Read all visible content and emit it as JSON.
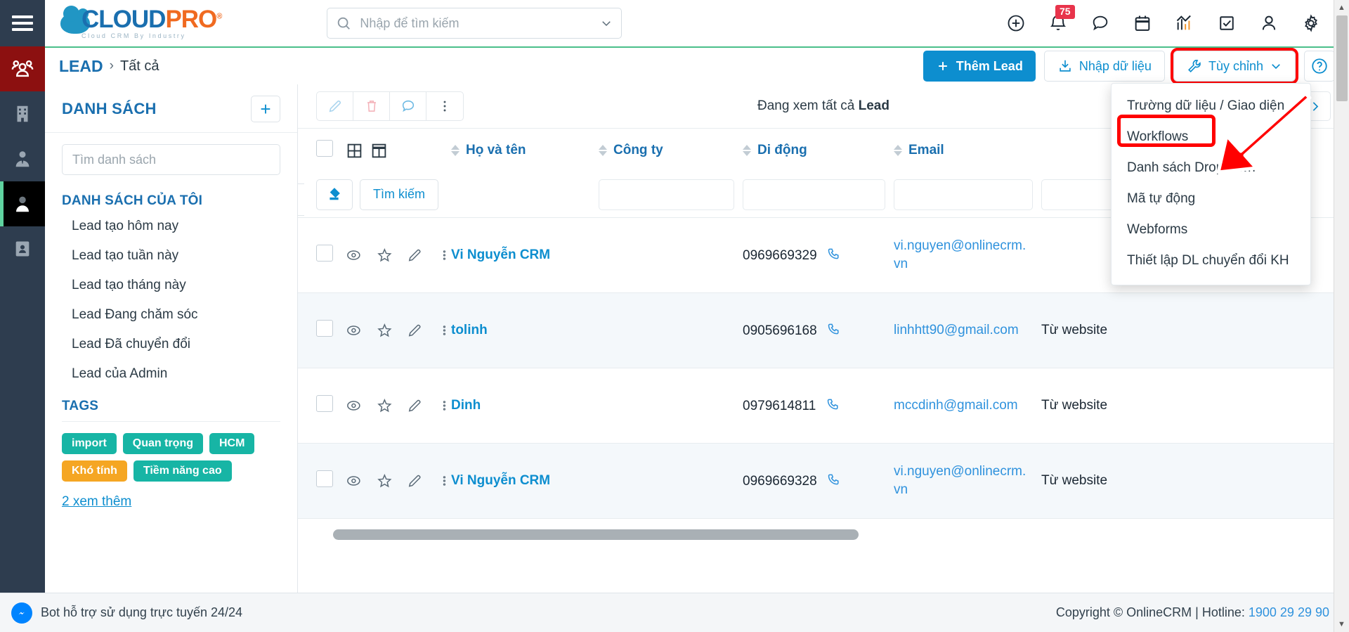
{
  "brand": {
    "name_part1": "CLOUD",
    "name_part2": "PRO",
    "registered": "®",
    "tagline": "Cloud CRM By Industry"
  },
  "topbar": {
    "search_placeholder": "Nhập để tìm kiếm",
    "notification_count": "75",
    "icons": [
      {
        "name": "add-circle-icon"
      },
      {
        "name": "bell-icon"
      },
      {
        "name": "chat-bubble-icon"
      },
      {
        "name": "calendar-icon"
      },
      {
        "name": "analytics-icon"
      },
      {
        "name": "task-checkbox-icon"
      },
      {
        "name": "user-icon"
      },
      {
        "name": "gear-icon"
      }
    ]
  },
  "breadcrumb": {
    "module": "LEAD",
    "separator": "›",
    "current": "Tất cả"
  },
  "actions": {
    "add_lead": "Thêm Lead",
    "import_data": "Nhập dữ liệu",
    "customize": "Tùy chỉnh",
    "help": "?"
  },
  "dropdown": {
    "items": [
      "Trường dữ liệu / Giao diện",
      "Workflows",
      "Danh sách Dropdown",
      "Mã tự động",
      "Webforms",
      "Thiết lập DL chuyển đổi KH"
    ],
    "highlighted": "Workflows"
  },
  "sidebar_list": {
    "title": "DANH SÁCH",
    "add_label": "+",
    "search_placeholder": "Tìm danh sách",
    "my_lists_title": "DANH SÁCH CỦA TÔI",
    "items": [
      "Lead tạo hôm nay",
      "Lead tạo tuần này",
      "Lead tạo tháng này",
      "Lead Đang chăm sóc",
      "Lead Đã chuyển đổi",
      "Lead của Admin"
    ],
    "tags_title": "TAGS",
    "tags": [
      {
        "label": "import",
        "color": "#17b5a5"
      },
      {
        "label": "Quan trọng",
        "color": "#17b5a5"
      },
      {
        "label": "HCM",
        "color": "#17b5a5"
      },
      {
        "label": "Khó tính",
        "color": "#f5a623"
      },
      {
        "label": "Tiềm năng cao",
        "color": "#17b5a5"
      }
    ],
    "more_label": "2  xem thêm"
  },
  "table_toolbar": {
    "tools": [
      {
        "name": "edit-pencil-icon"
      },
      {
        "name": "delete-trash-icon"
      },
      {
        "name": "comment-icon"
      },
      {
        "name": "more-vertical-icon"
      }
    ],
    "viewing_prefix": "Đang xem tất cả ",
    "viewing_entity": "Lead",
    "next_label": "›"
  },
  "table": {
    "columns": [
      {
        "key": "name",
        "label": "Họ và tên",
        "sortable": true
      },
      {
        "key": "company",
        "label": "Công ty",
        "sortable": true
      },
      {
        "key": "mobile",
        "label": "Di động",
        "sortable": true
      },
      {
        "key": "email",
        "label": "Email",
        "sortable": true
      },
      {
        "key": "source",
        "label": "",
        "sortable": false
      }
    ],
    "filter_row": {
      "erase_name": "erase-filter-icon",
      "search_label": "Tìm kiếm"
    },
    "rows": [
      {
        "name": "Vi Nguyễn CRM",
        "company": "",
        "mobile": "0969669329",
        "email": "vi.nguyen@onlinecrm.vn",
        "source": ""
      },
      {
        "name": "tolinh",
        "company": "",
        "mobile": "0905696168",
        "email": "linhhtt90@gmail.com",
        "source": "Từ website"
      },
      {
        "name": "Dinh",
        "company": "",
        "mobile": "0979614811",
        "email": "mccdinh@gmail.com",
        "source": "Từ website"
      },
      {
        "name": "Vi Nguyễn CRM",
        "company": "",
        "mobile": "0969669328",
        "email": "vi.nguyen@onlinecrm.vn",
        "source": "Từ website"
      }
    ]
  },
  "footer": {
    "bot_text": "Bot hỗ trợ sử dụng trực tuyến 24/24",
    "copyright": "Copyright © OnlineCRM | Hotline: ",
    "hotline": "1900 29 29 90"
  },
  "colors": {
    "accent_blue": "#0d8ecf",
    "brand_blue": "#1a6faf",
    "brand_orange": "#f06a20",
    "rail_dark": "#2e3d4f",
    "highlight_red": "#ff0000",
    "green_rule": "#4bbf8a"
  }
}
